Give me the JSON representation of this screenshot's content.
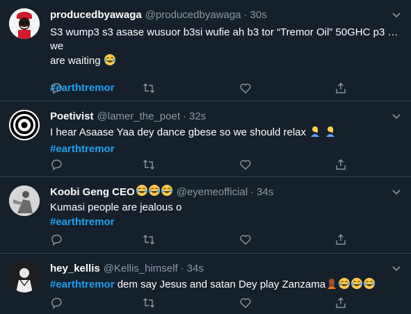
{
  "tweets": [
    {
      "name": "producedbyawaga",
      "handle": "@producedbyawaga",
      "dot": "·",
      "time": "30s",
      "line1": "S3 wump3 s3 asase wusuor b3si wufie ah b3 tor “Tremor Oil” 50GHC p3 … we",
      "line2": "are waiting",
      "hashtag": "#earthtremor"
    },
    {
      "name": "Poetivist",
      "handle": "@lamer_the_poet",
      "dot": "·",
      "time": "32s",
      "line1": "I hear Asaase Yaa dey dance gbese so we should relax",
      "hashtag": "#earthtremor"
    },
    {
      "name": "Koobi Geng CEO",
      "handle": "@eyemeofficial",
      "dot": "·",
      "time": "34s",
      "line1": "Kumasi people are jealous o",
      "hashtag": "#earthtremor"
    },
    {
      "name": "hey_kellis",
      "handle": "@Kellis_himself",
      "dot": "·",
      "time": "34s",
      "hashtag": "#earthtremor",
      "line1": "dem say Jesus and satan Dey play Zanzama"
    }
  ],
  "colors": {
    "background": "#15202b",
    "divider": "#38444d",
    "secondary_text": "#8899a6",
    "accent": "#1da1f2"
  },
  "icons": {
    "reply": "reply-icon",
    "retweet": "retweet-icon",
    "like": "like-icon",
    "share": "share-icon",
    "menu": "chevron-down-icon"
  }
}
